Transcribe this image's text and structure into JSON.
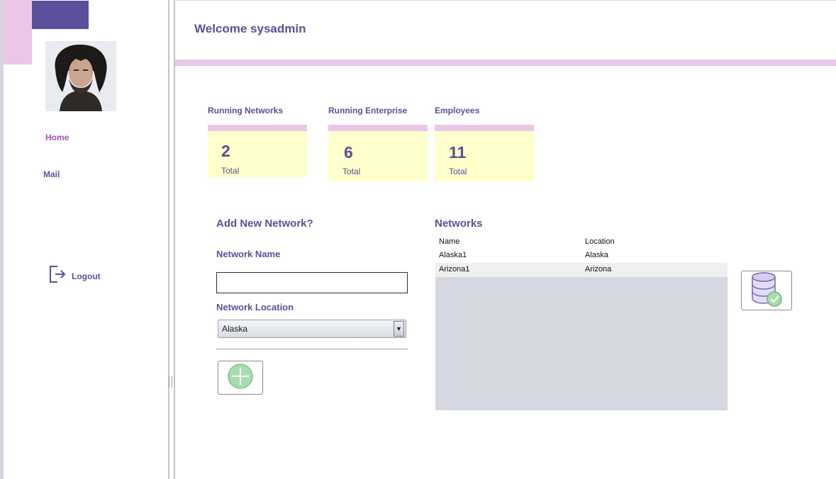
{
  "header": {
    "welcome": "Welcome sysadmin"
  },
  "sidebar": {
    "items": [
      {
        "label": "Home",
        "active": true
      },
      {
        "label": "Mail",
        "active": false
      }
    ],
    "logout_label": "Logout"
  },
  "stats": [
    {
      "title": "Running Networks",
      "value": "2",
      "label": "Total"
    },
    {
      "title": "Running Enterprise",
      "value": "6",
      "label": "Total"
    },
    {
      "title": "Employees",
      "value": "11",
      "label": "Total"
    }
  ],
  "form": {
    "title": "Add New Network?",
    "name_label": "Network Name",
    "name_value": "",
    "location_label": "Network Location",
    "location_value": "Alaska"
  },
  "networks": {
    "title": "Networks",
    "columns": [
      "Name",
      "Location"
    ],
    "rows": [
      [
        "Alaska1",
        "Alaska"
      ],
      [
        "Arizona1",
        "Arizona"
      ]
    ]
  },
  "colors": {
    "accent_purple": "#5c4f9b",
    "accent_pink": "#ecc6e6",
    "card_yellow": "#ffffcc",
    "active_nav": "#a451b4"
  },
  "icons": [
    "user-avatar",
    "logout-icon",
    "add-icon",
    "database-check-icon"
  ]
}
